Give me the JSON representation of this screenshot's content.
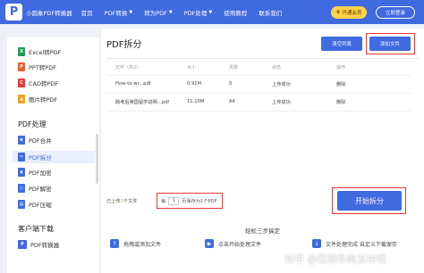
{
  "header": {
    "logo_text": "小圆象PDF转换器",
    "nav": [
      {
        "label": "首页",
        "has_caret": false
      },
      {
        "label": "PDF转换",
        "has_caret": true
      },
      {
        "label": "转为PDF",
        "has_caret": true
      },
      {
        "label": "PDF处理",
        "has_caret": true
      },
      {
        "label": "使用教程",
        "has_caret": false
      },
      {
        "label": "联系我们",
        "has_caret": false
      }
    ],
    "vip_label": "开通会员",
    "register_label": "立即登录"
  },
  "sidebar": {
    "convert_items": [
      {
        "label": "Excel转PDF",
        "icon": "excel-icon",
        "color": "#1f9d55"
      },
      {
        "label": "PPT转PDF",
        "icon": "ppt-icon",
        "color": "#e8602c"
      },
      {
        "label": "CAD转PDF",
        "icon": "cad-icon",
        "color": "#e53a3a"
      },
      {
        "label": "图片转PDF",
        "icon": "image-icon",
        "color": "#f0a020"
      }
    ],
    "group_process": "PDF处理",
    "process_items": [
      {
        "label": "PDF合并",
        "icon": "pdf-merge-icon",
        "active": false
      },
      {
        "label": "PDF拆分",
        "icon": "pdf-split-icon",
        "active": true
      },
      {
        "label": "PDF加密",
        "icon": "pdf-encrypt-icon",
        "active": false
      },
      {
        "label": "PDF解密",
        "icon": "pdf-decrypt-icon",
        "active": false
      },
      {
        "label": "PDF压缩",
        "icon": "pdf-compress-icon",
        "active": false
      }
    ],
    "group_download": "客户端下载",
    "download_item": "PDF转换器"
  },
  "main": {
    "title": "PDF拆分",
    "clear_label": "清空列表",
    "add_label": "添加文件",
    "columns": {
      "name": "文件（共2）",
      "size": "大小",
      "pages": "页数",
      "status": "状态",
      "op": "操作"
    },
    "rows": [
      {
        "name": "How-to-wr...pdf",
        "size": "0.91M",
        "pages": "0",
        "status": "上传成功",
        "op": "删除"
      },
      {
        "name": "跨考后英国留学说明...pdf",
        "size": "11.10M",
        "pages": "A4",
        "status": "上传成功",
        "op": "删除"
      }
    ],
    "uploaded_prefix": "已上传",
    "uploaded_count": "2",
    "uploaded_suffix": "个文件",
    "split_prefix": "每",
    "split_value": "1",
    "split_suffix": "页保存为1个PDF",
    "start_label": "开始拆分",
    "steps_title": "轻松三步搞定",
    "steps": [
      {
        "label": "拖拽或添加文件",
        "icon": "upload-icon"
      },
      {
        "label": "点击开始处理文件",
        "icon": "process-icon"
      },
      {
        "label": "文件处理完成 自定义下载保存",
        "icon": "download-icon"
      }
    ]
  },
  "watermark": "知乎 @红烧牛肉五块钱",
  "colors": {
    "brand": "#3f6ae0",
    "highlight": "#e53a3a",
    "vip": "#ffd24a"
  }
}
